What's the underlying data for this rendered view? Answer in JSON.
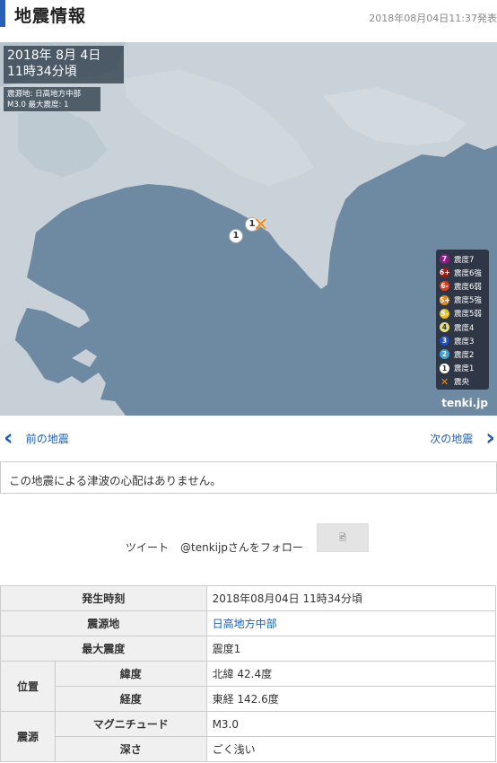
{
  "header": {
    "title": "地震情報",
    "timestamp": "2018年08月04日11:37発表"
  },
  "map": {
    "datetime_line1": "2018年  8月  4日",
    "datetime_line2": "11時34分頃",
    "epicenter_line": "震源地: 日高地方中部",
    "magnitude_line": "M3.0    最大震度: 1",
    "marker_label": "1",
    "legend": [
      {
        "label": "震度7",
        "mark": "7",
        "color": "#8b1a8b"
      },
      {
        "label": "震度6強",
        "mark": "6+",
        "color": "#a01818"
      },
      {
        "label": "震度6弱",
        "mark": "6-",
        "color": "#d84020"
      },
      {
        "label": "震度5強",
        "mark": "5+",
        "color": "#e08a20"
      },
      {
        "label": "震度5弱",
        "mark": "5-",
        "color": "#e8c020"
      },
      {
        "label": "震度4",
        "mark": "4",
        "color": "#e0e080"
      },
      {
        "label": "震度3",
        "mark": "3",
        "color": "#2050c0"
      },
      {
        "label": "震度2",
        "mark": "2",
        "color": "#40a0d0"
      },
      {
        "label": "震度1",
        "mark": "1",
        "color": "#ffffff"
      },
      {
        "label": "震央",
        "mark": "✕",
        "color": "#f08a1a"
      }
    ],
    "brand": "tenki.jp"
  },
  "nav": {
    "prev_label": "前の地震",
    "next_label": "次の地震"
  },
  "tsunami_text": "この地震による津波の心配はありません。",
  "social": {
    "tweet_label": "ツイート",
    "follow_label": "@tenkijpさんをフォロー"
  },
  "table": {
    "occurred_header": "発生時刻",
    "occurred_value": "2018年08月04日 11時34分頃",
    "epicenter_header": "震源地",
    "epicenter_value": "日高地方中部",
    "max_intensity_header": "最大震度",
    "max_intensity_value": "震度1",
    "position_header": "位置",
    "latitude_header": "緯度",
    "latitude_value": "北緯 42.4度",
    "longitude_header": "経度",
    "longitude_value": "東経 142.6度",
    "source_header": "震源",
    "magnitude_header": "マグニチュード",
    "magnitude_value": "M3.0",
    "depth_header": "深さ",
    "depth_value": "ごく浅い"
  }
}
